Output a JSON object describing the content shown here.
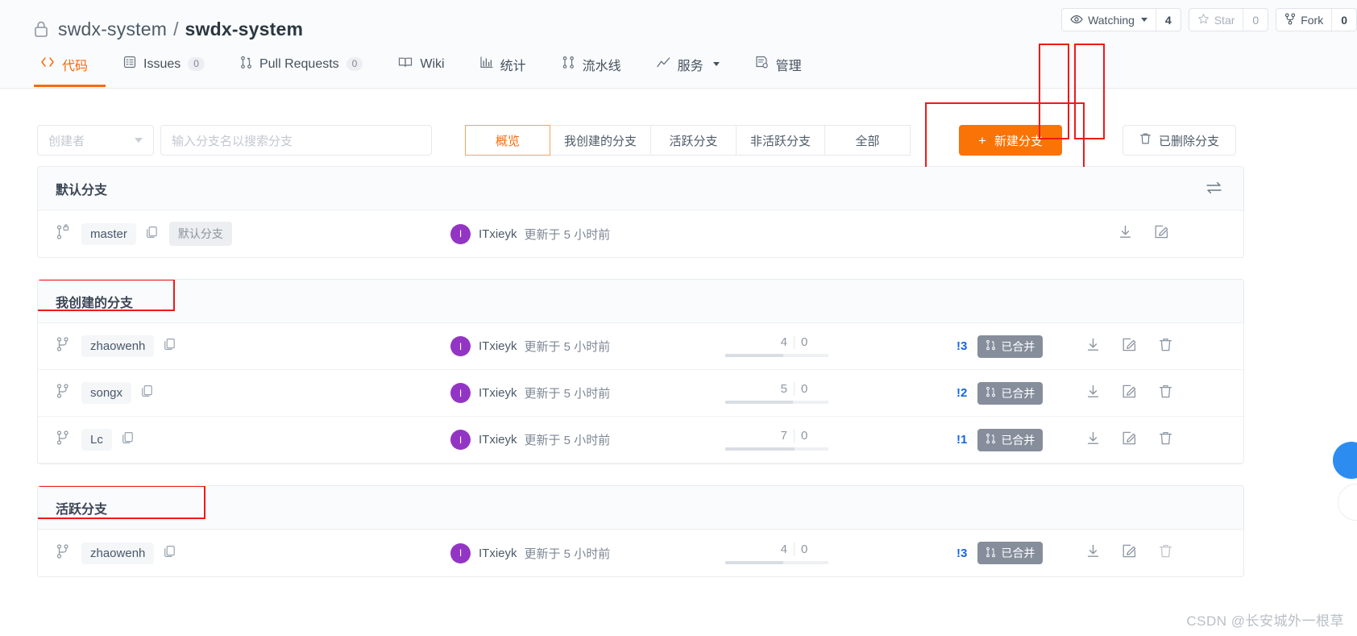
{
  "header": {
    "lock_icon": "lock-icon",
    "owner": "swdx-system",
    "separator": "/",
    "repo": "swdx-system",
    "actions": [
      {
        "icon": "eye-icon",
        "label": "Watching",
        "has_caret": true,
        "count": "4",
        "dim": false
      },
      {
        "icon": "star-icon",
        "label": "Star",
        "has_caret": false,
        "count": "0",
        "dim": true
      },
      {
        "icon": "fork-icon",
        "label": "Fork",
        "has_caret": false,
        "count": "0",
        "dim": false
      }
    ],
    "nav": [
      {
        "icon": "code-icon",
        "label": "代码",
        "badge": null,
        "active": true,
        "caret": false
      },
      {
        "icon": "issue-icon",
        "label": "Issues",
        "badge": "0",
        "active": false,
        "caret": false
      },
      {
        "icon": "pr-icon",
        "label": "Pull Requests",
        "badge": "0",
        "active": false,
        "caret": false
      },
      {
        "icon": "book-icon",
        "label": "Wiki",
        "badge": null,
        "active": false,
        "caret": false
      },
      {
        "icon": "chart-icon",
        "label": "统计",
        "badge": null,
        "active": false,
        "caret": false
      },
      {
        "icon": "pipeline-icon",
        "label": "流水线",
        "badge": null,
        "active": false,
        "caret": false
      },
      {
        "icon": "service-icon",
        "label": "服务",
        "badge": null,
        "active": false,
        "caret": true
      },
      {
        "icon": "manage-icon",
        "label": "管理",
        "badge": null,
        "active": false,
        "caret": false
      }
    ]
  },
  "toolbar": {
    "creator_select": {
      "value": "创建者",
      "icon": "chevron-down-icon"
    },
    "search": {
      "placeholder": "输入分支名以搜索分支",
      "value": ""
    },
    "segments": [
      {
        "label": "概览",
        "active": true
      },
      {
        "label": "我创建的分支",
        "active": false
      },
      {
        "label": "活跃分支",
        "active": false
      },
      {
        "label": "非活跃分支",
        "active": false
      },
      {
        "label": "全部",
        "active": false
      }
    ],
    "new_branch": {
      "label": "新建分支",
      "plus": "+",
      "color": "#f97306"
    },
    "deleted_branches": {
      "label": "已删除分支",
      "icon": "trash-icon"
    }
  },
  "annotations": {
    "highlight_color": "#ef1919",
    "boxes": [
      "new-branch-button",
      "my-branches-title",
      "active-branches-title",
      "edit-icon-column",
      "delete-icon-column"
    ]
  },
  "sections": [
    {
      "title": "默认分支",
      "has_swap_icon": true,
      "swap_icon": "swap-icon",
      "highlight_title": false,
      "rows": [
        {
          "branch": "master",
          "copy_icon": "copy-icon",
          "default_tag": "默认分支",
          "avatar_letter": "I",
          "author": "ITxieyk",
          "updated": "更新于 5 小时前",
          "behind": null,
          "ahead": null,
          "pr_count": null,
          "merged_label": null,
          "actions": [
            "download-icon",
            "edit-icon"
          ]
        }
      ]
    },
    {
      "title": "我创建的分支",
      "has_swap_icon": false,
      "highlight_title": true,
      "rows": [
        {
          "branch": "zhaowenh",
          "copy_icon": "copy-icon",
          "default_tag": null,
          "avatar_letter": "I",
          "author": "ITxieyk",
          "updated": "更新于 5 小时前",
          "behind": "4",
          "ahead": "0",
          "pr_count": "!3",
          "merged_label": "已合并",
          "actions": [
            "download-icon",
            "edit-icon",
            "delete-icon"
          ]
        },
        {
          "branch": "songx",
          "copy_icon": "copy-icon",
          "default_tag": null,
          "avatar_letter": "I",
          "author": "ITxieyk",
          "updated": "更新于 5 小时前",
          "behind": "5",
          "ahead": "0",
          "pr_count": "!2",
          "merged_label": "已合并",
          "actions": [
            "download-icon",
            "edit-icon",
            "delete-icon"
          ]
        },
        {
          "branch": "Lc",
          "copy_icon": "copy-icon",
          "default_tag": null,
          "avatar_letter": "I",
          "author": "ITxieyk",
          "updated": "更新于 5 小时前",
          "behind": "7",
          "ahead": "0",
          "pr_count": "!1",
          "merged_label": "已合并",
          "actions": [
            "download-icon",
            "edit-icon",
            "delete-icon"
          ]
        }
      ]
    },
    {
      "title": "活跃分支",
      "has_swap_icon": false,
      "highlight_title": true,
      "rows": [
        {
          "branch": "zhaowenh",
          "copy_icon": "copy-icon",
          "default_tag": null,
          "avatar_letter": "I",
          "author": "ITxieyk",
          "updated": "更新于 5 小时前",
          "behind": "4",
          "ahead": "0",
          "pr_count": "!3",
          "merged_label": "已合并",
          "actions": [
            "download-icon",
            "edit-icon",
            "delete-icon"
          ]
        }
      ]
    }
  ],
  "watermark": "CSDN @长安城外一根草"
}
